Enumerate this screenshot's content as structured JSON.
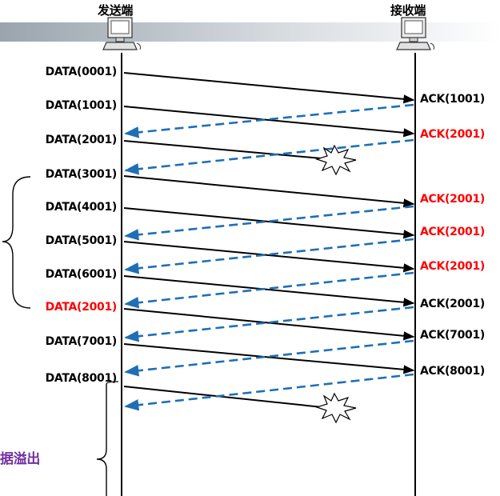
{
  "colors": {
    "data_arrow": "#000000",
    "ack_arrow": "#1f6fb5",
    "highlight": "#ff0000",
    "caption": "#7030a0",
    "text": "#000000"
  },
  "sender": {
    "title": "发送端",
    "icon": "computer-icon"
  },
  "receiver": {
    "title": "接收端",
    "icon": "computer-icon"
  },
  "caption": "据溢出",
  "data_labels": [
    {
      "text": "DATA(0001)",
      "color": "#000000"
    },
    {
      "text": "DATA(1001)",
      "color": "#000000"
    },
    {
      "text": "DATA(2001)",
      "color": "#000000"
    },
    {
      "text": "DATA(3001)",
      "color": "#000000"
    },
    {
      "text": "DATA(4001)",
      "color": "#000000"
    },
    {
      "text": "DATA(5001)",
      "color": "#000000"
    },
    {
      "text": "DATA(6001)",
      "color": "#000000"
    },
    {
      "text": "DATA(2001)",
      "color": "#ff0000"
    },
    {
      "text": "DATA(7001)",
      "color": "#000000"
    },
    {
      "text": "DATA(8001)",
      "color": "#000000"
    }
  ],
  "ack_labels": [
    {
      "text": "ACK(1001)",
      "color": "#000000"
    },
    {
      "text": "ACK(2001)",
      "color": "#ff0000"
    },
    {
      "text": "ACK(2001)",
      "color": "#ff0000"
    },
    {
      "text": "ACK(2001)",
      "color": "#ff0000"
    },
    {
      "text": "ACK(2001)",
      "color": "#ff0000"
    },
    {
      "text": "ACK(2001)",
      "color": "#000000"
    },
    {
      "text": "ACK(7001)",
      "color": "#000000"
    },
    {
      "text": "ACK(8001)",
      "color": "#000000"
    }
  ]
}
